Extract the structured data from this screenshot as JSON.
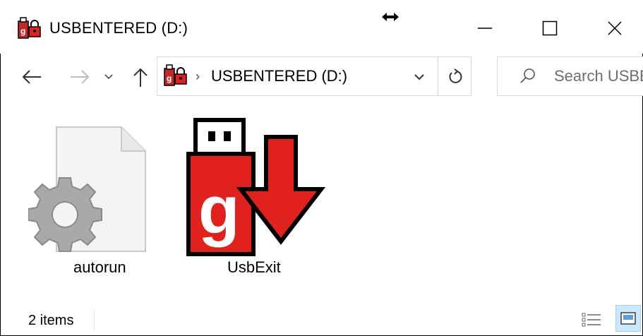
{
  "window": {
    "title": "USBENTERED (D:)",
    "title_icon": "usb-drive-lock-icon"
  },
  "controls": {
    "minimize_icon": "minimize-icon",
    "maximize_icon": "maximize-icon",
    "close_icon": "close-icon",
    "cursor_icon": "resize-horizontal-cursor-icon"
  },
  "nav": {
    "back_icon": "back-arrow-icon",
    "forward_icon": "forward-arrow-icon",
    "recent_icon": "chevron-down-icon",
    "up_icon": "up-arrow-icon",
    "breadcrumb_separator": "›",
    "address": "USBENTERED (D:)",
    "refresh_icon": "refresh-icon"
  },
  "search": {
    "placeholder": "Search USBE",
    "icon": "search-icon"
  },
  "files": [
    {
      "name": "autorun",
      "icon": "settings-file-icon"
    },
    {
      "name": "UsbExit",
      "icon": "usb-exit-icon"
    }
  ],
  "status": {
    "item_count": "2 items",
    "views": [
      "details-view-icon",
      "large-icons-view-icon"
    ],
    "active_view": "large-icons-view-icon"
  },
  "colors": {
    "brand_red": "#e0211d",
    "selection_bg": "#cce8ff",
    "border": "#d9d9d9"
  }
}
